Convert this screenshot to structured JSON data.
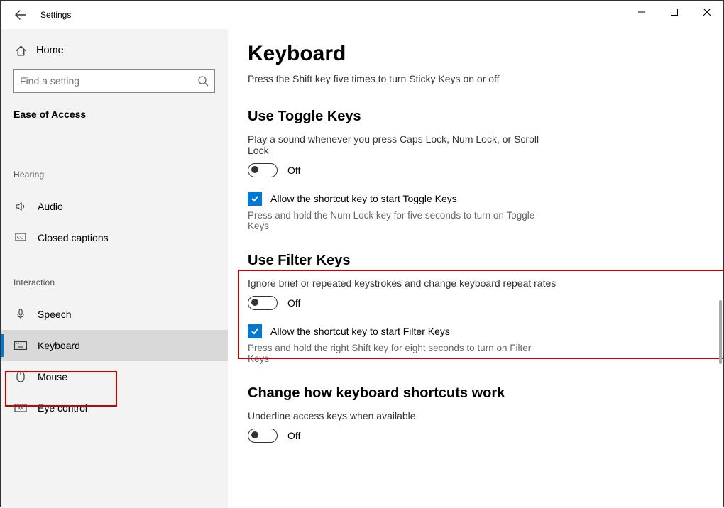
{
  "window": {
    "title": "Settings"
  },
  "sidebar": {
    "home": "Home",
    "search_placeholder": "Find a setting",
    "ease_label": "Ease of Access",
    "group_hearing": "Hearing",
    "group_interaction": "Interaction",
    "items": {
      "audio": "Audio",
      "closed_captions": "Closed captions",
      "speech": "Speech",
      "keyboard": "Keyboard",
      "mouse": "Mouse",
      "eye_control": "Eye control"
    }
  },
  "main": {
    "title": "Keyboard",
    "sticky_sub": "Press the Shift key five times to turn Sticky Keys on or off",
    "toggle_keys": {
      "title": "Use Toggle Keys",
      "desc": "Play a sound whenever you press Caps Lock, Num Lock, or Scroll Lock",
      "state": "Off",
      "check_label": "Allow the shortcut key to start Toggle Keys",
      "check_desc": "Press and hold the Num Lock key for five seconds to turn on Toggle Keys"
    },
    "filter_keys": {
      "title": "Use Filter Keys",
      "desc": "Ignore brief or repeated keystrokes and change keyboard repeat rates",
      "state": "Off",
      "check_label": "Allow the shortcut key to start Filter Keys",
      "check_desc": "Press and hold the right Shift key for eight seconds to turn on Filter Keys"
    },
    "shortcuts": {
      "title": "Change how keyboard shortcuts work",
      "desc": "Underline access keys when available",
      "state": "Off"
    }
  }
}
